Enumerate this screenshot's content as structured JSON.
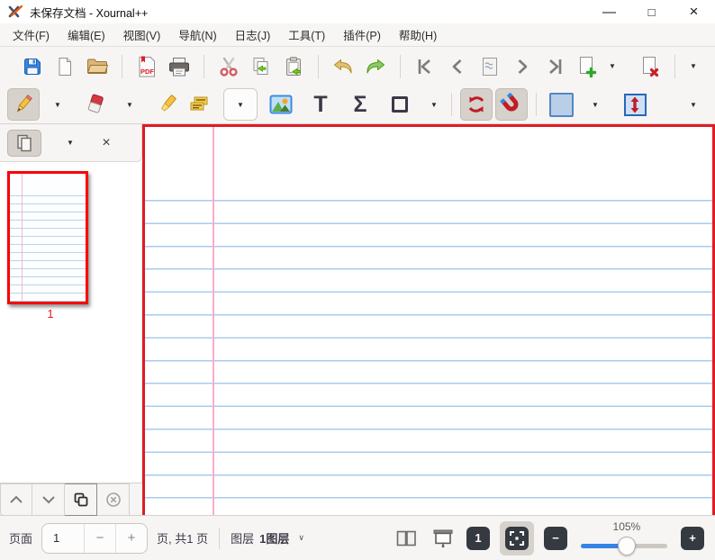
{
  "window": {
    "title": "未保存文档 - Xournal++",
    "controls": {
      "minimize": "—",
      "maximize": "□",
      "close": "×"
    }
  },
  "menubar": {
    "items": [
      "文件(F)",
      "编辑(E)",
      "视图(V)",
      "导航(N)",
      "日志(J)",
      "工具(T)",
      "插件(P)",
      "帮助(H)"
    ]
  },
  "icons": {
    "app": "xournalpp-logo",
    "save": "blue-floppy-disk",
    "new_document": "blank-page",
    "open": "folder",
    "export_pdf": "page-with-PDF",
    "print": "printer",
    "cut": "scissors",
    "copy": "two-pages-green-arrow",
    "paste": "clipboard-green-arrow",
    "undo": "curved-arrow-left-tan",
    "redo": "curved-arrow-right-green",
    "first_page": "chevron-bar-left",
    "previous_page": "chevron-left",
    "goto_page": "page-preview",
    "next_page": "chevron-right",
    "last_page": "chevron-bar-right",
    "add_page": "page-green-plus",
    "delete_page": "page-red-cross",
    "pen": "yellow-pencil",
    "eraser": "red-eraser",
    "highlighter": "yellow-marker",
    "select_text": "pdf-text-selection",
    "image": "picture-landscape",
    "text_glyph": "T",
    "math_glyph": "Σ",
    "shape": "square-outline",
    "rotation_snap": "red-circular-arrows",
    "grid_snap": "red-magnet",
    "color_swatch": "light-blue-square",
    "vertical_space": "red-vertical-arrows-in-blue-box",
    "dropdown": "▼",
    "layer_dropdown": "∨",
    "sidebar_pages": "stacked-pages",
    "page_up": "chevron-up",
    "page_down": "chevron-down",
    "duplicate": "overlapping-squares",
    "delete_circle": "circled-cross",
    "dual_page": "two-pages-side-by-side",
    "presentation": "projector-screen",
    "zoom_fit": "fit-corners"
  },
  "sidebar": {
    "thumbnail_label": "1"
  },
  "statusbar": {
    "page_label": "页面",
    "page_value": "1",
    "decrement": "−",
    "increment": "+",
    "pages_total": "页, 共1 页",
    "layer_label": "图层",
    "layer_value": "1图层",
    "zoom_value": "105%",
    "zoom_100": "1",
    "zoom_out": "−",
    "zoom_in": "+"
  },
  "colors": {
    "canvas_border": "#e01b24",
    "thumbnail_border": "#fb0006",
    "rule_line_blue": "#a9cbee",
    "margin_line_pink": "#f8aecd",
    "slider_fill_blue": "#3584e4",
    "swatch_fill": "#b9cfe8",
    "swatch_border": "#5286c5",
    "toolbar_bg": "#f6f5f4"
  }
}
